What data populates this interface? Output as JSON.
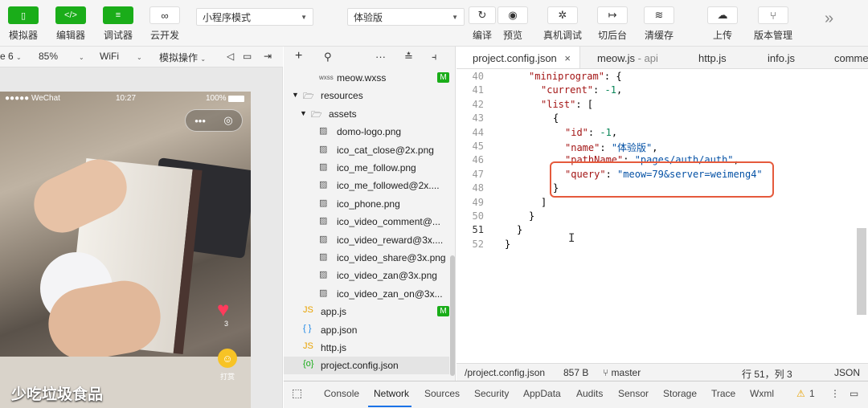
{
  "toolbar": {
    "simulator": "模拟器",
    "editor": "编辑器",
    "debugger": "调试器",
    "cloud": "云开发",
    "mode_select": "小程序模式",
    "version_select": "体验版",
    "compile": "编译",
    "preview": "预览",
    "device_debug": "真机调试",
    "background": "切后台",
    "clear_cache": "清缓存",
    "upload": "上传",
    "version_mgmt": "版本管理",
    "more": "»"
  },
  "subbar": {
    "device": "e 6",
    "zoom": "85%",
    "network": "WiFi",
    "sim_ops": "模拟操作"
  },
  "phone": {
    "carrier": "●●●●● WeChat",
    "time": "10:27",
    "battery": "100%",
    "caption": "少吃垃圾食品",
    "like_count": "3",
    "reward_label": "打赏"
  },
  "explorer": {
    "toolbar": {
      "add": "+",
      "search": "⚲",
      "more": "···",
      "collapse": "≛",
      "split": "⫞"
    },
    "items": [
      {
        "label": "meow.wxss",
        "icon": "wxss",
        "badge": "M"
      },
      {
        "label": "resources",
        "icon": "folder",
        "expanded": true
      },
      {
        "label": "assets",
        "icon": "folder",
        "expanded": true
      },
      {
        "label": "domo-logo.png",
        "icon": "image"
      },
      {
        "label": "ico_cat_close@2x.png",
        "icon": "image"
      },
      {
        "label": "ico_me_follow.png",
        "icon": "image"
      },
      {
        "label": "ico_me_followed@2x....",
        "icon": "image"
      },
      {
        "label": "ico_phone.png",
        "icon": "image"
      },
      {
        "label": "ico_video_comment@...",
        "icon": "image"
      },
      {
        "label": "ico_video_reward@3x....",
        "icon": "image"
      },
      {
        "label": "ico_video_share@3x.png",
        "icon": "image"
      },
      {
        "label": "ico_video_zan@3x.png",
        "icon": "image"
      },
      {
        "label": "ico_video_zan_on@3x...",
        "icon": "image"
      },
      {
        "label": "app.js",
        "icon": "js",
        "badge": "M"
      },
      {
        "label": "app.json",
        "icon": "json"
      },
      {
        "label": "http.js",
        "icon": "js"
      },
      {
        "label": "project.config.json",
        "icon": "config",
        "selected": true
      }
    ]
  },
  "tabs": [
    {
      "label": "project.config.json",
      "close": "×"
    },
    {
      "label": "meow.js",
      "sub": "- api"
    },
    {
      "label": "http.js"
    },
    {
      "label": "info.js"
    },
    {
      "label": "comme"
    }
  ],
  "editor": {
    "lines": [
      {
        "n": "40",
        "tokens": [
          {
            "t": "k",
            "v": "\"miniprogram\""
          },
          {
            "t": "p",
            "v": ": {"
          }
        ]
      },
      {
        "n": "41",
        "tokens": [
          {
            "t": "k",
            "v": "\"current\""
          },
          {
            "t": "p",
            "v": ": "
          },
          {
            "t": "n",
            "v": "-1"
          },
          {
            "t": "p",
            "v": ","
          }
        ]
      },
      {
        "n": "42",
        "tokens": [
          {
            "t": "k",
            "v": "\"list\""
          },
          {
            "t": "p",
            "v": ": ["
          }
        ]
      },
      {
        "n": "43",
        "tokens": [
          {
            "t": "p",
            "v": "{"
          }
        ]
      },
      {
        "n": "44",
        "tokens": [
          {
            "t": "k",
            "v": "\"id\""
          },
          {
            "t": "p",
            "v": ": "
          },
          {
            "t": "n",
            "v": "-1"
          },
          {
            "t": "p",
            "v": ","
          }
        ]
      },
      {
        "n": "45",
        "tokens": [
          {
            "t": "k",
            "v": "\"name\""
          },
          {
            "t": "p",
            "v": ": "
          },
          {
            "t": "s",
            "v": "\"体验版\""
          },
          {
            "t": "p",
            "v": ","
          }
        ]
      },
      {
        "n": "46",
        "tokens": [
          {
            "t": "k",
            "v": "\"pathName\""
          },
          {
            "t": "p",
            "v": ": "
          },
          {
            "t": "s",
            "v": "\"pages/auth/auth\""
          },
          {
            "t": "p",
            "v": ","
          }
        ]
      },
      {
        "n": "47",
        "tokens": [
          {
            "t": "k",
            "v": "\"query\""
          },
          {
            "t": "p",
            "v": ": "
          },
          {
            "t": "s",
            "v": "\"meow=79&server=weimeng4\""
          }
        ]
      },
      {
        "n": "48",
        "tokens": [
          {
            "t": "p",
            "v": "}"
          }
        ]
      },
      {
        "n": "49",
        "tokens": [
          {
            "t": "p",
            "v": "]"
          }
        ]
      },
      {
        "n": "50",
        "tokens": [
          {
            "t": "p",
            "v": "}"
          }
        ]
      },
      {
        "n": "51",
        "tokens": [
          {
            "t": "p",
            "v": "}"
          }
        ]
      },
      {
        "n": "52",
        "tokens": [
          {
            "t": "p",
            "v": "}"
          }
        ]
      }
    ]
  },
  "statusbar": {
    "path": "/project.config.json",
    "size": "857 B",
    "branch": "master",
    "position": "行 51，列 3",
    "lang": "JSON"
  },
  "devtools": {
    "tabs": [
      "Console",
      "Network",
      "Sources",
      "Security",
      "AppData",
      "Audits",
      "Sensor",
      "Storage",
      "Trace",
      "Wxml"
    ],
    "active": "Network",
    "warnings": "1"
  }
}
